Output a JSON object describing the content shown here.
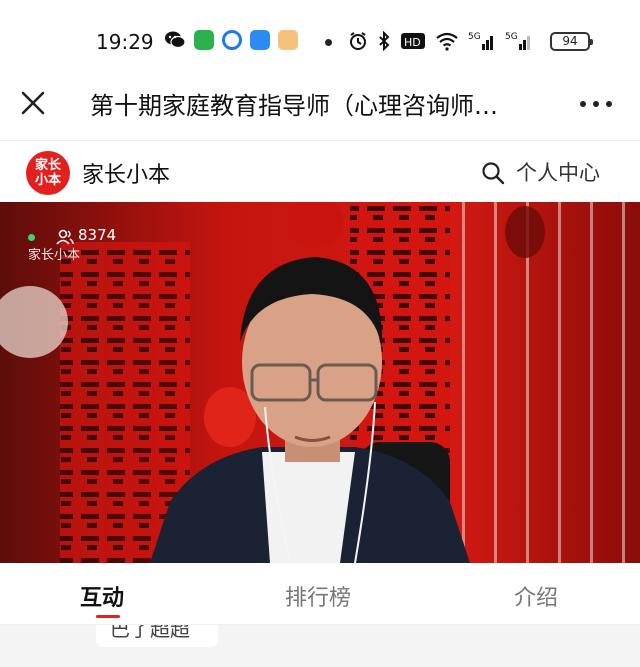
{
  "status_bar": {
    "time": "19:29",
    "battery": "94",
    "app_icons": [
      "wechat-icon",
      "app-green-icon",
      "app-blue-circle-icon",
      "app-blue-square-icon",
      "app-avatar-icon"
    ],
    "right_icons": [
      "alarm-icon",
      "bluetooth-icon",
      "hd-icon",
      "wifi-icon",
      "signal-5g-icon",
      "signal-5g-2-icon"
    ],
    "colors": {
      "text": "#111111"
    }
  },
  "titlebar": {
    "title": "第十期家庭教育指导师（心理咨询师…",
    "close_icon": "close-icon",
    "more_icon": "more-horizontal-icon"
  },
  "app_header": {
    "logo_text": "家长小本",
    "brand": "家长小本",
    "search_icon": "search-icon",
    "personal_center": "个人中心",
    "accent": "#e4201e"
  },
  "live": {
    "viewer_count": "8374",
    "watermark": "家长小本",
    "viewer_icon": "people-icon"
  },
  "tabs": {
    "items": [
      {
        "label": "互动",
        "active": true
      },
      {
        "label": "排行榜",
        "active": false
      },
      {
        "label": "介绍",
        "active": false
      }
    ],
    "accent": "#e4201e"
  },
  "content_peek": {
    "chip_text": "巴了超超"
  }
}
